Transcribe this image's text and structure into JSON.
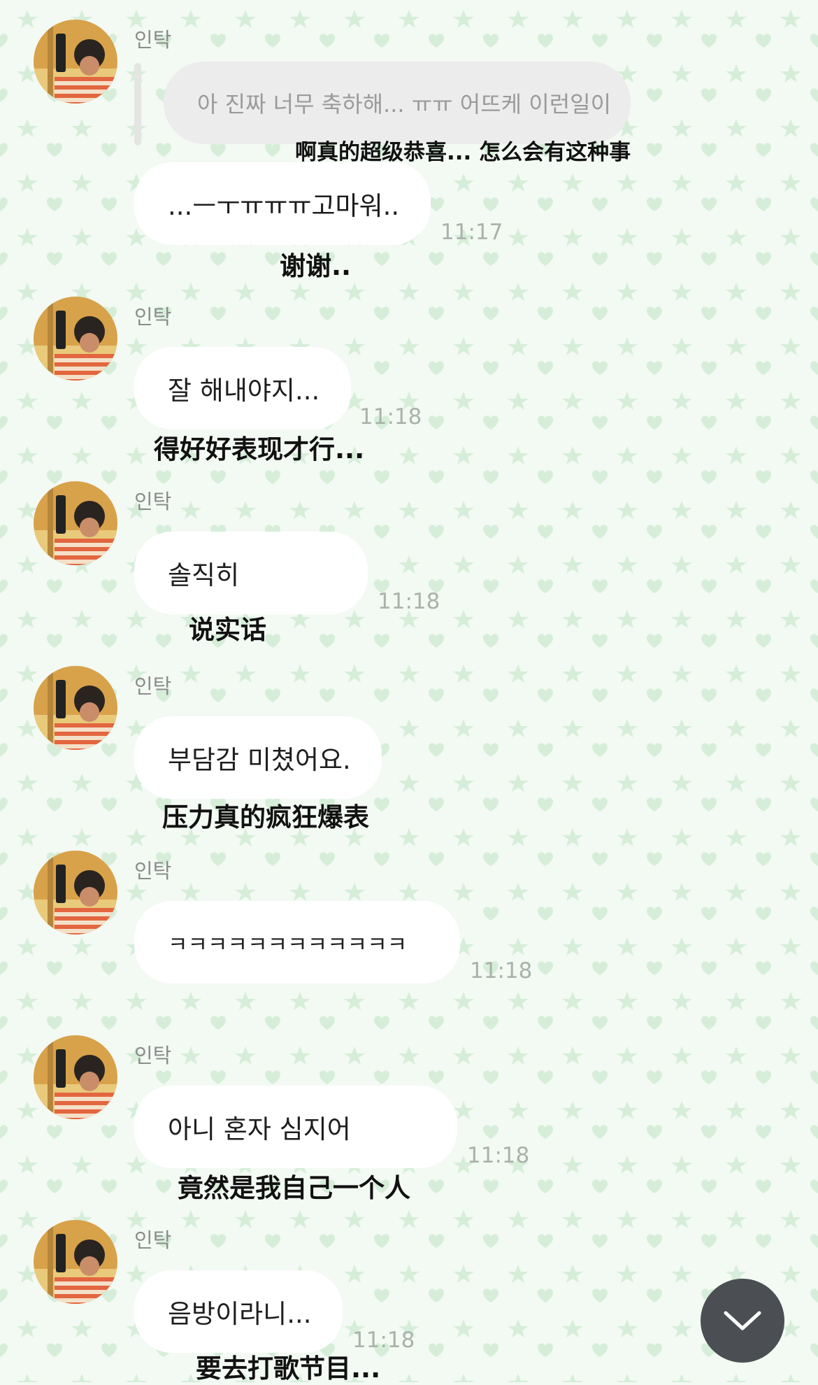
{
  "messages": [
    {
      "sender": "인탁",
      "avatar_icon": "profile-photo",
      "reply_quote": "아 진짜 너무 축하해... ㅠㅠ 어뜨케 이런일이",
      "reply_translation": "啊真的超级恭喜... 怎么会有这种事",
      "text": "...ㅡㅜㅠㅠㅠ고마워..",
      "time": "11:17",
      "translation": "谢谢.."
    },
    {
      "sender": "인탁",
      "avatar_icon": "profile-photo",
      "text": "잘 해내야지...",
      "time": "11:18",
      "translation": "得好好表现才行..."
    },
    {
      "sender": "인탁",
      "avatar_icon": "profile-photo",
      "text": "솔직히",
      "time": "11:18",
      "translation": "说实话"
    },
    {
      "sender": "인탁",
      "avatar_icon": "profile-photo",
      "text": "부담감 미쳤어요.",
      "time": "",
      "translation": "压力真的疯狂爆表"
    },
    {
      "sender": "인탁",
      "avatar_icon": "profile-photo",
      "text": "ㅋㅋㅋㅋㅋㅋㅋㅋㅋㅋㅋㅋ",
      "time": "11:18",
      "translation": ""
    },
    {
      "sender": "인탁",
      "avatar_icon": "profile-photo",
      "text": "아니 혼자 심지어",
      "time": "11:18",
      "translation": "竟然是我自己一个人"
    },
    {
      "sender": "인탁",
      "avatar_icon": "profile-photo",
      "text": "음방이라니...",
      "time": "11:18",
      "translation": "要去打歌节目..."
    }
  ],
  "scroll_button_icon": "chevron-down-icon",
  "colors": {
    "background": "#f3f9f3",
    "pattern": "#d9f0dc",
    "bubble": "#ffffff",
    "reply_bubble": "#ececec",
    "scroll_button": "#4b4e52"
  }
}
